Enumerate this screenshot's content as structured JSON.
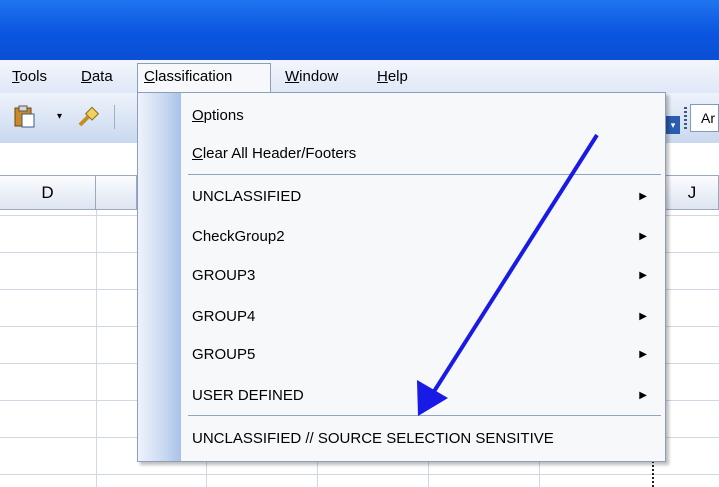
{
  "menubar": {
    "items": [
      {
        "label": "Tools",
        "mnemonic": "T",
        "rest": "ools"
      },
      {
        "label": "Data",
        "mnemonic": "D",
        "rest": "ata"
      },
      {
        "label": "Classification",
        "mnemonic": "C",
        "rest": "lassification"
      },
      {
        "label": "Window",
        "mnemonic": "W",
        "rest": "indow"
      },
      {
        "label": "Help",
        "mnemonic": "H",
        "rest": "elp"
      }
    ]
  },
  "toolbar": {
    "font_box_text": "Ar",
    "icons": [
      "paste-icon",
      "format-painter-icon"
    ]
  },
  "sheet": {
    "column_headers": [
      "D",
      "J"
    ]
  },
  "classification_menu": {
    "options": {
      "mnemonic": "O",
      "rest": "ptions"
    },
    "clear_all": {
      "mnemonic": "C",
      "rest": "lear All Header/Footers"
    },
    "submenus": [
      "UNCLASSIFIED",
      "CheckGroup2",
      "GROUP3",
      "GROUP4",
      "GROUP5",
      "USER DEFINED"
    ],
    "final_item": "UNCLASSIFIED // SOURCE SELECTION SENSITIVE",
    "submenu_arrow": "▶"
  },
  "annotation": {
    "arrow_color": "#1a1ae6"
  }
}
